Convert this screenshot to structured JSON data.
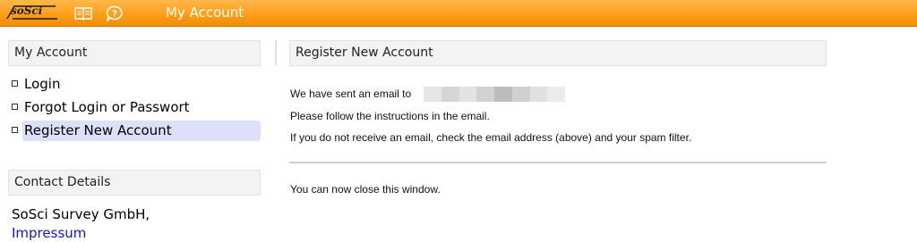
{
  "topbar": {
    "logo_text": "soSci",
    "manual_icon": "book-icon",
    "help_icon": "help-icon",
    "title": "My Account",
    "color": "#ff9f1a"
  },
  "sidebar": {
    "account_header": "My Account",
    "items": [
      {
        "label": "Login",
        "active": false
      },
      {
        "label": "Forgot Login or Passwort",
        "active": false
      },
      {
        "label": "Register New Account",
        "active": true
      }
    ],
    "contact_header": "Contact Details",
    "contact_company": "SoSci Survey GmbH,",
    "contact_link": "Impressum"
  },
  "main": {
    "header": "Register New Account",
    "line1": "We have sent an email to",
    "line2": "Please follow the instructions in the email.",
    "line3": "If you do not receive an email, check the email address (above) and your spam filter.",
    "close_note": "You can now close this window."
  }
}
